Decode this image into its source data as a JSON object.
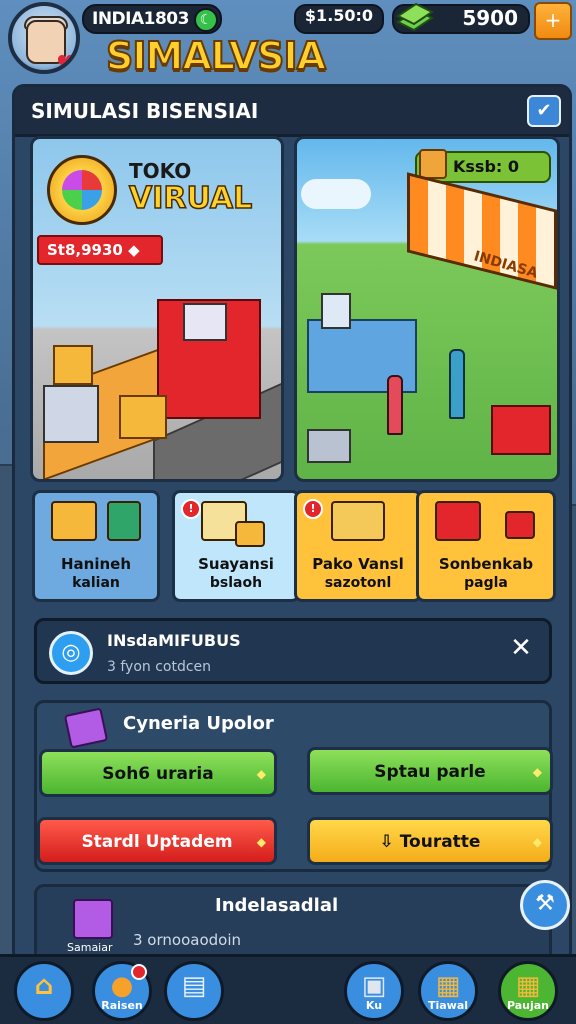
{
  "header": {
    "player_name": "INDIA1803",
    "game_title": "SIMALVSIA",
    "coins": "$1.50:0",
    "cash": "5900",
    "add_label": "+"
  },
  "panel": {
    "title": "SIMULASI BISENSIAI"
  },
  "scene_left": {
    "title_top": "TOKO",
    "title_main": "VIRUAL",
    "price": "St8,9930 ◆"
  },
  "scene_right": {
    "key_badge": "Kssb: 0",
    "shop_sign": "INDIASA"
  },
  "tiles": [
    {
      "line1": "Hanineh",
      "line2": "kalian",
      "bg": "#6ea9e0",
      "notif": ""
    },
    {
      "line1": "Suayansi",
      "line2": "bslaoh",
      "bg": "#bfe6fb",
      "notif": "!"
    },
    {
      "line1": "Pako Vansl",
      "line2": "sazotonl",
      "bg": "#ffc23a",
      "notif": "!"
    },
    {
      "line1": "Sonbenkab",
      "line2": "pagla",
      "bg": "#ffc23a",
      "notif": ""
    }
  ],
  "notice": {
    "title": "INsdaMIFUBUS",
    "subtitle": "3 fyon cotdcen",
    "close": "✕"
  },
  "upgrade": {
    "title": "Cyneria Upolor",
    "btn1": "Soh6 uraria",
    "btn2": "Sptau parle",
    "btn3": "Stardl Uptadem",
    "btn4": "Touratte"
  },
  "info": {
    "title": "Indelasadlal",
    "subtitle": "3 ornooaodoin",
    "caption": "Samaiar"
  },
  "nav": {
    "home": "",
    "raisen": "Raisen",
    "shop": "",
    "ku": "Ku",
    "tiawal": "Tiawal",
    "paujan": "Paujan"
  },
  "colors": {
    "title_yellow": "#ffcf2e",
    "green": "#4cb531",
    "red": "#d51d1d",
    "yellow": "#f5ac1a",
    "blue": "#3a8ee0"
  }
}
